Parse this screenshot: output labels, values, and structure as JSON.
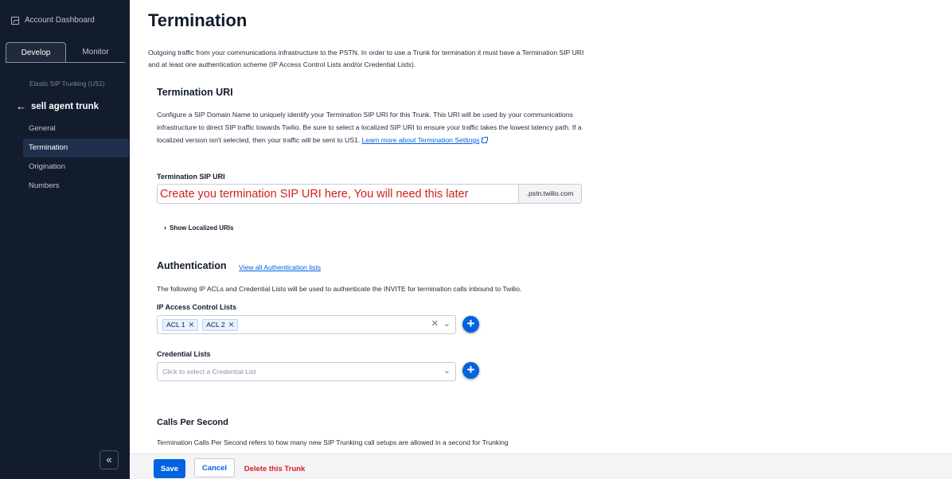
{
  "sidebar": {
    "account_label": "Account Dashboard",
    "tabs": [
      {
        "label": "Develop"
      },
      {
        "label": "Monitor"
      }
    ],
    "context": "Elastic SIP Trunking (US1)",
    "trunk_name": "sell agent trunk",
    "nav": [
      {
        "label": "General"
      },
      {
        "label": "Termination"
      },
      {
        "label": "Origination"
      },
      {
        "label": "Numbers"
      }
    ],
    "collapse_glyph": "«"
  },
  "page": {
    "title": "Termination",
    "intro": "Outgoing traffic from your communications infrastructure to the PSTN. In order to use a Trunk for termination it must have a Termination SIP URI and at least one authentication scheme (IP Access Control Lists and/or Credential Lists)."
  },
  "termination_uri": {
    "heading": "Termination URI",
    "description": "Configure a SIP Domain Name to uniquely identify your Termination SIP URI for this Trunk. This URI will be used by your communications infrastructure to direct SIP traffic towards Twilio. Be sure to select a localized SIP URI to ensure your traffic takes the lowest latency path. If a localized version isn't selected, then your traffic will be sent to US1.",
    "learn_more": "Learn more about Termination Settings",
    "field_label": "Termination SIP URI",
    "field_value": "Create you termination SIP URI here, You will need this later",
    "suffix": ".pstn.twilio.com",
    "show_localized": "Show Localized URIs"
  },
  "authentication": {
    "heading": "Authentication",
    "view_all": "View all Authentication lists",
    "description": "The following IP ACLs and Credential Lists will be used to authenticate the INVITE for termination calls inbound to Twilio.",
    "acl_label": "IP Access Control Lists",
    "acl_items": [
      {
        "label": "ACL 1"
      },
      {
        "label": "ACL 2"
      }
    ],
    "cred_label": "Credential Lists",
    "cred_placeholder": "Click to select a Credential List"
  },
  "cps": {
    "heading": "Calls Per Second",
    "description": "Termination Calls Per Second refers to how many new SIP Trunking call setups are allowed in a second for Trunking"
  },
  "footer": {
    "save": "Save",
    "cancel": "Cancel",
    "delete": "Delete this Trunk"
  },
  "colors": {
    "sidebar_bg": "#121c2d",
    "accent": "#0263e0",
    "danger": "#d61f1f",
    "annotation": "#d0211c"
  }
}
